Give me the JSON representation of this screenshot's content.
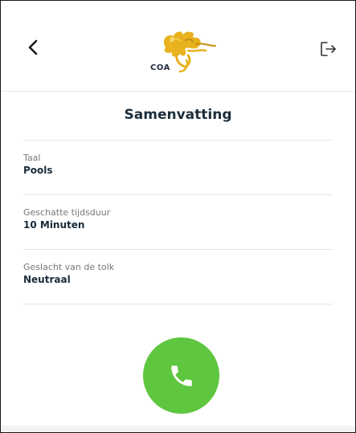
{
  "header": {
    "logo_text": "COA",
    "back_icon": "chevron-left-icon",
    "logout_icon": "logout-icon"
  },
  "page": {
    "title": "Samenvatting"
  },
  "summary": [
    {
      "label": "Taal",
      "value": "Pools"
    },
    {
      "label": "Geschatte tijdsduur",
      "value": "10 Minuten"
    },
    {
      "label": "Geslacht van de tolk",
      "value": "Neutraal"
    }
  ],
  "call_button": {
    "icon": "phone-icon",
    "color": "#5ec63f"
  },
  "colors": {
    "logo_gold": "#e8b21e",
    "text_dark": "#1c2d3a"
  }
}
